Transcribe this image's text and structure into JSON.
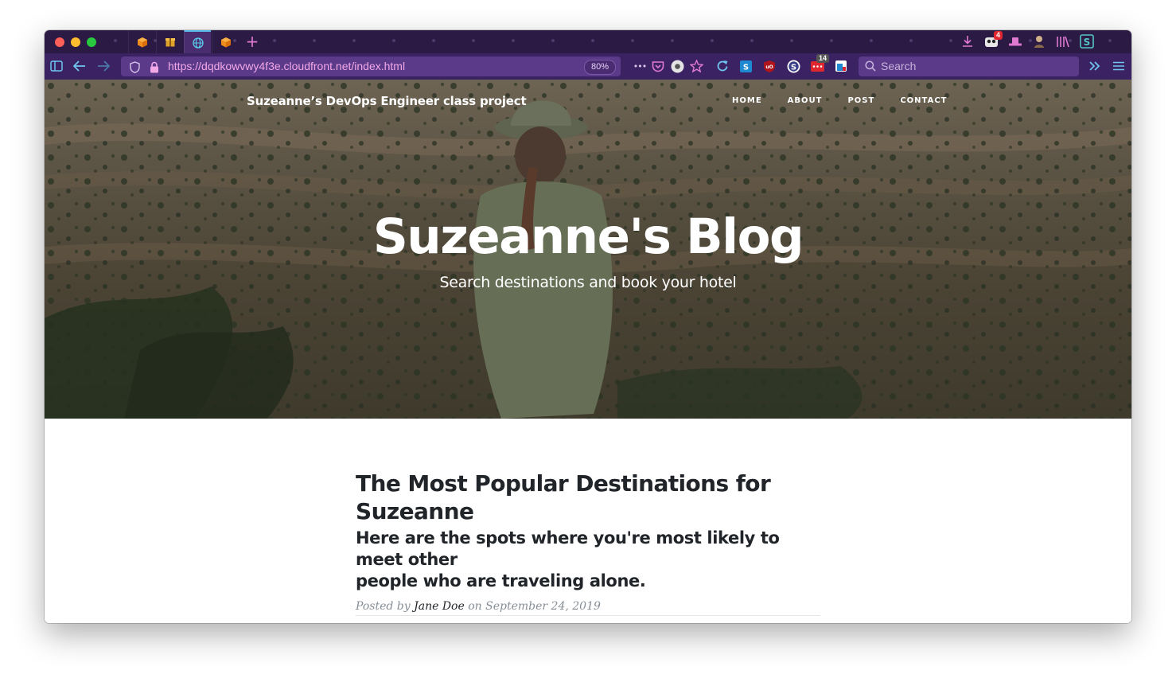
{
  "browser": {
    "url_prefix": "https://",
    "url_host": "dqdkowvwy4f3e.cloudfront.net",
    "url_path": "/index.html",
    "zoom": "80%",
    "search_placeholder": "Search",
    "more_dots": "•••",
    "badges": {
      "extension_badge_top": "4",
      "extension_badge_nav": "14"
    },
    "tabs": [
      {
        "icon": "orange-cube-icon"
      },
      {
        "icon": "package-box-icon"
      },
      {
        "icon": "globe-icon",
        "active": true
      },
      {
        "icon": "orange-cube-icon"
      }
    ],
    "colors": {
      "tabstrip": "#2a1a44",
      "toolbar": "#3b2263",
      "urlbar": "#5b3a8a",
      "url_text": "#f2a8e6"
    }
  },
  "site": {
    "brand": "Suzeanne’s DevOps Engineer class project",
    "nav": [
      "HOME",
      "ABOUT",
      "POST",
      "CONTACT"
    ],
    "hero_title": "Suzeanne's Blog",
    "hero_subtitle": "Search destinations and book your hotel"
  },
  "post": {
    "title_line1": "The Most Popular Destinations for",
    "title_line2": "Suzeanne",
    "subtitle_line1": "Here are the spots where you're most likely to meet other",
    "subtitle_line2": "people who are traveling alone.",
    "meta_prefix": "Posted by ",
    "author": "Jane Doe",
    "meta_on": " on ",
    "date": "September 24, 2019"
  }
}
